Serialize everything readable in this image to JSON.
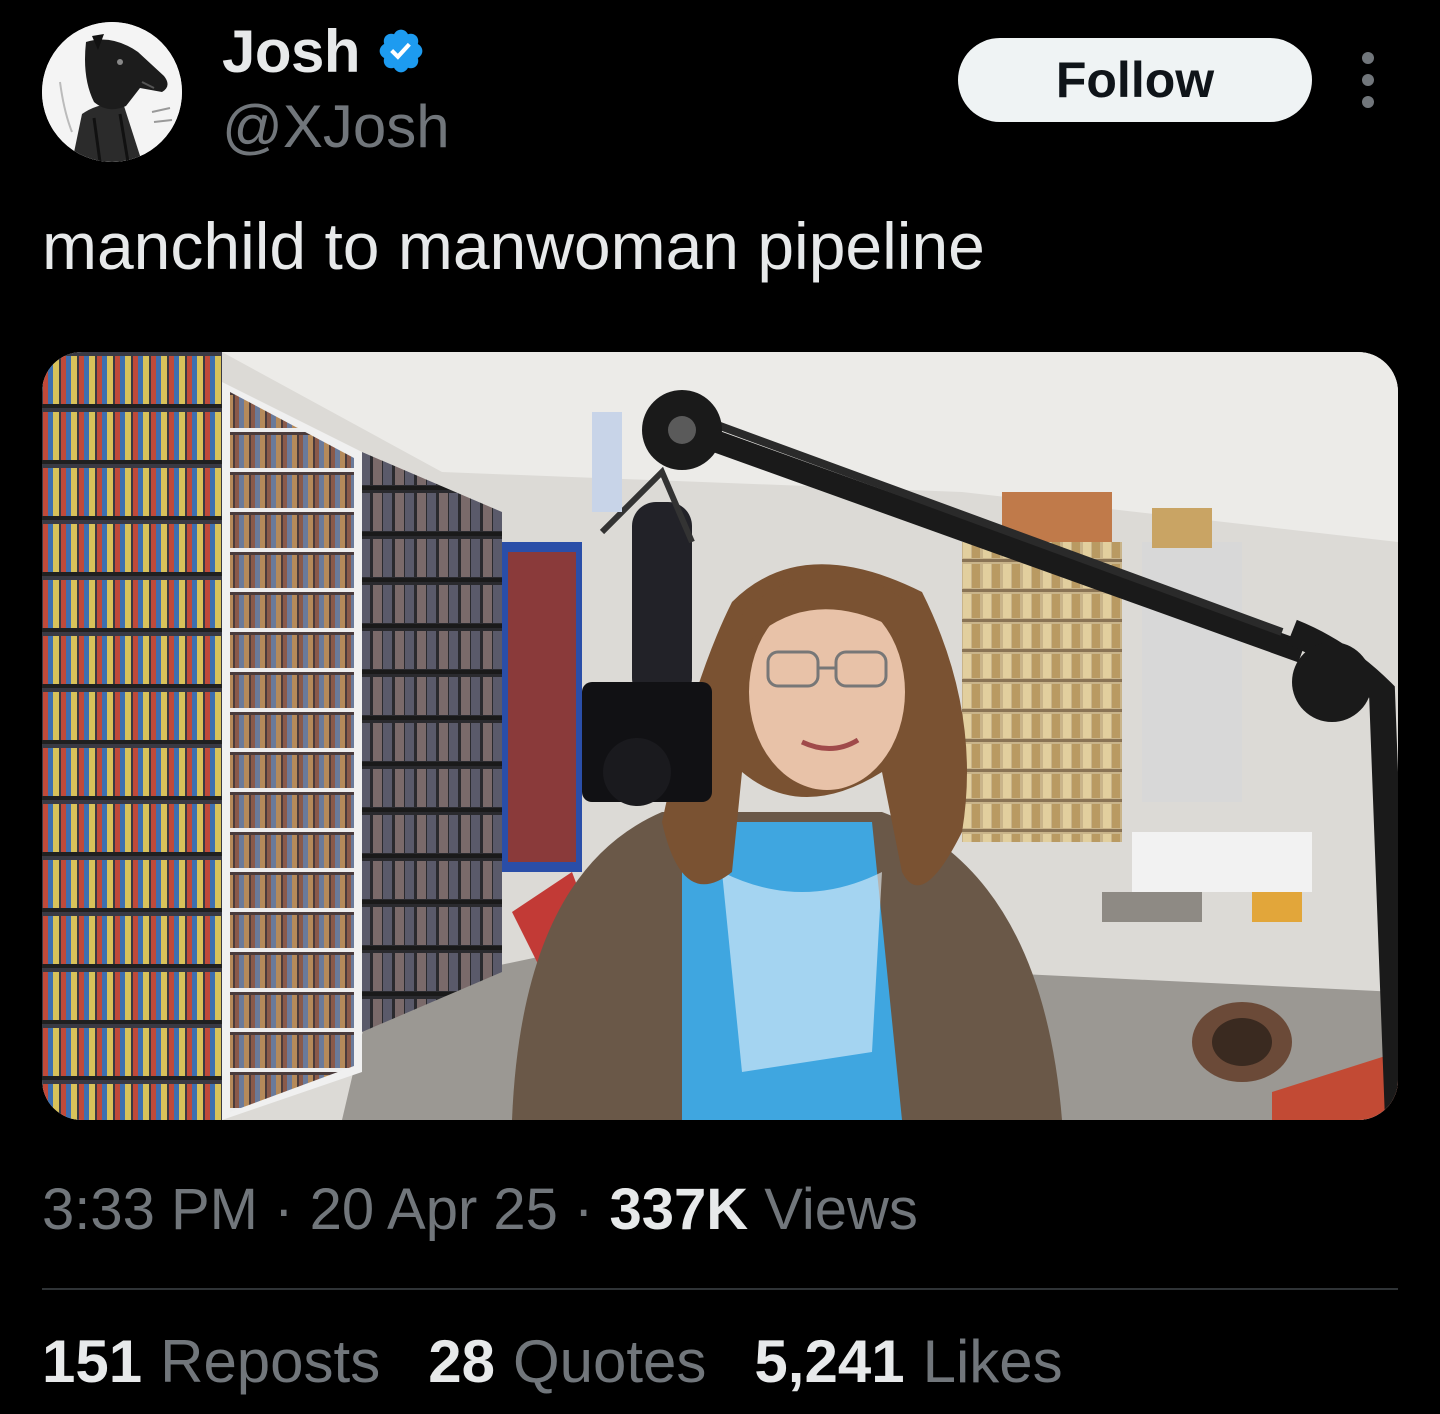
{
  "author": {
    "display_name": "Josh",
    "handle": "@XJosh",
    "verified": true,
    "avatar_icon": "horse-head-avatar"
  },
  "actions": {
    "follow_label": "Follow",
    "more_icon": "more-vertical-icon"
  },
  "tweet": {
    "text": "manchild to manwoman pipeline",
    "media_icon": "video-still-image"
  },
  "meta": {
    "time": "3:33 PM",
    "separator": "·",
    "date": "20 Apr 25",
    "views_count": "337K",
    "views_label": "Views"
  },
  "stats": {
    "reposts_count": "151",
    "reposts_label": "Reposts",
    "quotes_count": "28",
    "quotes_label": "Quotes",
    "likes_count": "5,241",
    "likes_label": "Likes"
  },
  "colors": {
    "background": "#000000",
    "text_primary": "#e7e9ea",
    "text_secondary": "#71767b",
    "verified_blue": "#1d9bf0",
    "follow_bg": "#eff3f4",
    "divider": "#2f3336"
  }
}
